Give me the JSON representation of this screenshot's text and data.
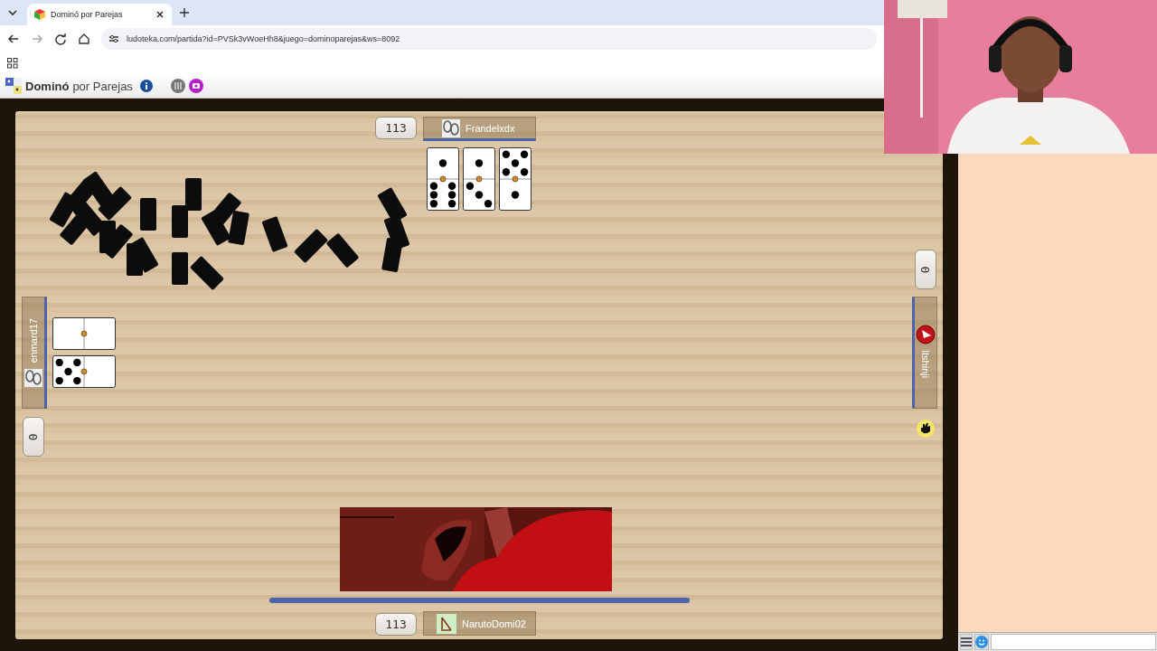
{
  "browser": {
    "tab_title": "Dominó por Parejas",
    "url": "ludoteka.com/partida?id=PVSk3vWoeHh8&juego=dominoparejas&ws=8092"
  },
  "game_header": {
    "title": "Dominó",
    "subtitle": "por Parejas"
  },
  "players": [
    {
      "kind": "top",
      "name": "Frandelxdx",
      "score": "113",
      "tiles": [
        {
          "halves": [
            {
              "kind": "one"
            },
            {
              "kind": "six"
            }
          ]
        },
        {
          "halves": [
            {
              "kind": "one"
            },
            {
              "kind": "three"
            }
          ]
        },
        {
          "halves": [
            {
              "kind": "five"
            },
            {
              "kind": "one"
            }
          ]
        }
      ]
    },
    {
      "kind": "left",
      "name": "enmard17",
      "score": "0",
      "tiles": [
        {
          "halves": [
            {
              "kind": "blank"
            },
            {
              "kind": "blank"
            }
          ]
        },
        {
          "halves": [
            {
              "kind": "five"
            },
            {
              "kind": "blank"
            }
          ]
        }
      ]
    },
    {
      "kind": "right",
      "name": "Itshinji",
      "score": "0"
    },
    {
      "kind": "bottom",
      "name": "NarutoDomi02",
      "score": "113"
    }
  ],
  "turn": {
    "kind": "right"
  }
}
